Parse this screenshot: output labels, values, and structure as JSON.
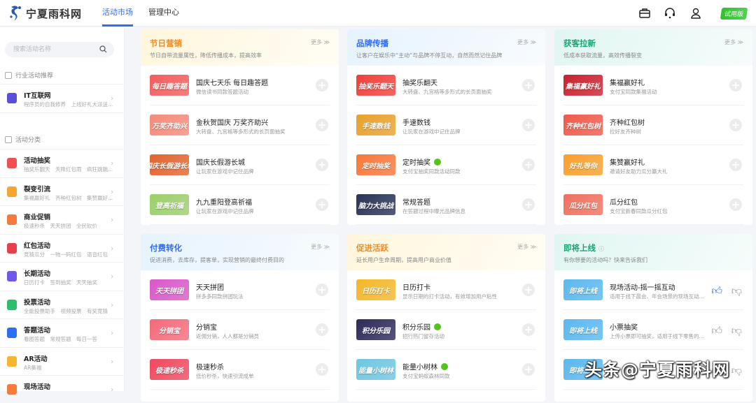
{
  "header": {
    "brand": "宁夏雨科网",
    "nav": [
      "活动市场",
      "管理中心"
    ],
    "icons": [
      "briefcase-icon",
      "headset-icon",
      "user-icon"
    ],
    "trial": "试用版"
  },
  "sidebar": {
    "search_placeholder": "搜索活动名称",
    "industry_title": "行业活动推荐",
    "industry": {
      "title": "IT互联网",
      "sub": "程序员的自我修养　上线好礼大派送..."
    },
    "category_title": "活动分类",
    "categories": [
      {
        "title": "活动抽奖",
        "sub": "抽奖乐翻天　天降红包雨　疯狂跳跳...",
        "color": "#f0504f"
      },
      {
        "title": "裂变引流",
        "sub": "集福赢好礼　齐种红包树　集赞赢好...",
        "color": "#f7a531"
      },
      {
        "title": "商业促销",
        "sub": "极速秒杀　天天拼团　全民砍价",
        "color": "#f47b3c"
      },
      {
        "title": "红包活动",
        "sub": "竞猜瓜分　一物一码红包　语音红包",
        "color": "#e8404a"
      },
      {
        "title": "长期活动",
        "sub": "日历打卡　签到抽奖　天天抽奖",
        "color": "#6e5ae6"
      },
      {
        "title": "投票活动",
        "sub": "全能投票助手　视频投票　有奖竞猜",
        "color": "#2ebd6b"
      },
      {
        "title": "答题活动",
        "sub": "看图答题　常规答题　每日一答",
        "color": "#2e6ef0"
      },
      {
        "title": "AR活动",
        "sub": "AR集福",
        "color": "#f5b731"
      },
      {
        "title": "现场活动",
        "sub": "",
        "color": "#f47b3c"
      }
    ]
  },
  "more_label": "更多 ≫",
  "cards": [
    {
      "title": "节日营销",
      "sub": "节日自带流量属性，降低传播成本，提高效率",
      "color": "#f08a24",
      "bg": "#fff6dc",
      "items": [
        {
          "title": "国庆七天乐 每日趣答题",
          "sub": "微信读书同款答题活动",
          "thumb": "每日趣答题",
          "c": "#f25d5d"
        },
        {
          "title": "金秋贺国庆 万奖齐助兴",
          "sub": "大转盘、九宫格等多形式的长页面抽奖",
          "thumb": "万奖齐助兴",
          "c": "#f58a7a"
        },
        {
          "title": "国庆长假游长城",
          "sub": "让玩家在游戏中记住品牌",
          "thumb": "国庆长假游长城",
          "c": "#e2642f"
        },
        {
          "title": "九九重阳登高祈福",
          "sub": "让玩家在游戏中记住品牌",
          "thumb": "登高祈福",
          "c": "#9bcf6a"
        }
      ]
    },
    {
      "title": "品牌传播",
      "sub": "让客户在娱乐中“主动”与品牌不停互动，自然而然记住品牌",
      "color": "#2f6bff",
      "bg": "#e6f3fd",
      "items": [
        {
          "title": "抽奖乐翻天",
          "sub": "大转盘、九宫格等多形式的长页面抽奖",
          "thumb": "抽奖乐翻天",
          "c": "#f0403a"
        },
        {
          "title": "手速数钱",
          "sub": "让玩家在游戏中记住品牌",
          "thumb": "手速数钱",
          "c": "#e8a12c"
        },
        {
          "title": "定时抽奖",
          "sub": "支付宝抽奖同款活动同款",
          "thumb": "定时抽奖",
          "c": "#f7773a",
          "badge": true
        },
        {
          "title": "常规答题",
          "sub": "在答题过程中曝光品牌信息",
          "thumb": "脑力大挑战",
          "c": "#2a3357"
        }
      ]
    },
    {
      "title": "获客拉新",
      "sub": "低成本获取流量，高效传播裂变",
      "color": "#1aa672",
      "bg": "#e0f6f2",
      "items": [
        {
          "title": "集福赢好礼",
          "sub": "支付宝同款集福活动",
          "thumb": "集福赢好礼",
          "c": "#c9222e"
        },
        {
          "title": "齐种红包树",
          "sub": "拉好友齐种树",
          "thumb": "齐种红包树",
          "c": "#f05a4a"
        },
        {
          "title": "集赞赢好礼",
          "sub": "邀请好友助力瓜分赢大礼",
          "thumb": "好礼等你",
          "c": "#f7a02c"
        },
        {
          "title": "瓜分红包",
          "sub": "支付宝新春同款瓜分红包",
          "thumb": "瓜分红包",
          "c": "#f0705e"
        }
      ]
    },
    {
      "title": "付费转化",
      "sub": "促进消费，去库存，提客单，实现营销的最终付费目的",
      "color": "#2f6bff",
      "bg": "#e6f3fd",
      "items": [
        {
          "title": "天天拼团",
          "sub": "拼多多同款拼团玩法",
          "thumb": "天天拼团",
          "c": "#d958c8"
        },
        {
          "title": "分销宝",
          "sub": "返佣分销，人人都是分销员",
          "thumb": "分销宝",
          "c": "#f46a7a"
        },
        {
          "title": "极速秒杀",
          "sub": "低价秒杀，快速引流成单",
          "thumb": "极速秒杀",
          "c": "#f0485f"
        }
      ]
    },
    {
      "title": "促进活跃",
      "sub": "延长用户生命周期，提高用户商业价值",
      "color": "#f08a24",
      "bg": "#fff6dc",
      "items": [
        {
          "title": "日历打卡",
          "sub": "显示日期的打卡活动，有效增加用户粘性",
          "thumb": "日历打卡",
          "c": "#f3b72a"
        },
        {
          "title": "积分乐园",
          "sub": "招行热门留存活动",
          "thumb": "积分乐园",
          "c": "#2d2a5a",
          "badge": true
        },
        {
          "title": "能量小树林",
          "sub": "支付宝蚂蚁森林同款",
          "thumb": "能量小树林",
          "c": "#6ec6e0",
          "badge": true
        }
      ]
    },
    {
      "title": "即将上线",
      "sub": "有你想要的活动吗？快来告诉我们",
      "color": "#1aa672",
      "bg": "#e0f6f2",
      "help": true,
      "vote": true,
      "items": [
        {
          "title": "现场活动-摇一摇互动",
          "sub": "适用于线下晨会、年会场景的现场互动玩法",
          "thumb": "即将上线",
          "c": "#5bb8ee",
          "liked": true
        },
        {
          "title": "小票抽奖",
          "sub": "上传小票即可抽奖，适用于线下零售的营...",
          "thumb": "即将上线",
          "c": "#5bb8ee"
        },
        {
          "title": "",
          "sub": "",
          "thumb": "即将上线",
          "c": "#5bb8ee"
        }
      ]
    }
  ],
  "watermark": "头条@宁夏雨科网"
}
